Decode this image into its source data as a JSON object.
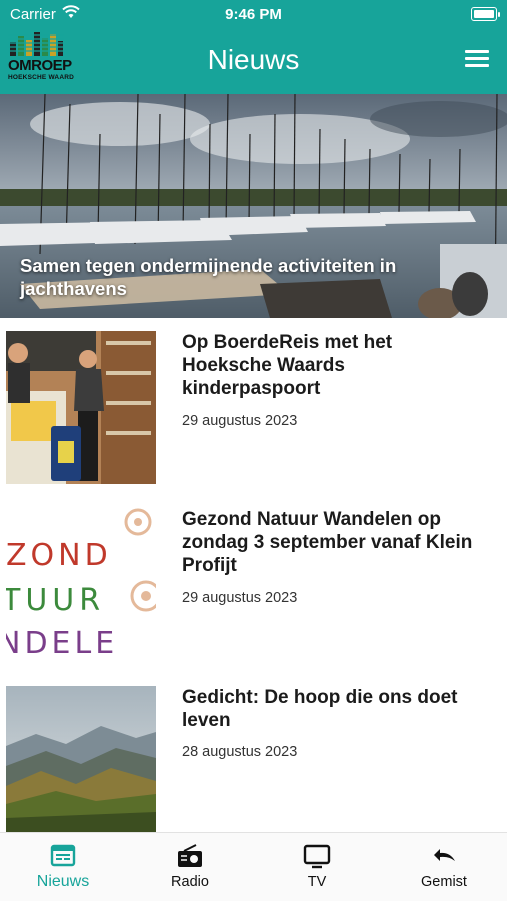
{
  "status": {
    "carrier": "Carrier",
    "time": "9:46 PM"
  },
  "header": {
    "logo_main": "OMROEP",
    "logo_sub": "HOEKSCHE WAARD",
    "title": "Nieuws",
    "menu_icon": "hamburger-menu-icon"
  },
  "hero": {
    "title": "Samen tegen ondermijnende activiteiten in jachthavens"
  },
  "articles": [
    {
      "title": "Op BoerdeReis met het Hoeksche Waards kinderpaspoort",
      "date": "29 augustus 2023"
    },
    {
      "title": "Gezond Natuur Wandelen op zondag 3 september vanaf Klein Profijt",
      "date": "29 augustus 2023",
      "thumb_text": [
        "ZOND",
        "TUUR",
        "NDELE"
      ]
    },
    {
      "title": "Gedicht: De hoop die ons doet leven",
      "date": "28 augustus 2023"
    }
  ],
  "tabs": [
    {
      "label": "Nieuws",
      "icon": "newspaper-icon",
      "active": true
    },
    {
      "label": "Radio",
      "icon": "radio-icon",
      "active": false
    },
    {
      "label": "TV",
      "icon": "tv-icon",
      "active": false
    },
    {
      "label": "Gemist",
      "icon": "undo-arrow-icon",
      "active": false
    }
  ],
  "colors": {
    "accent": "#17a49a",
    "text": "#1b1b1b"
  }
}
